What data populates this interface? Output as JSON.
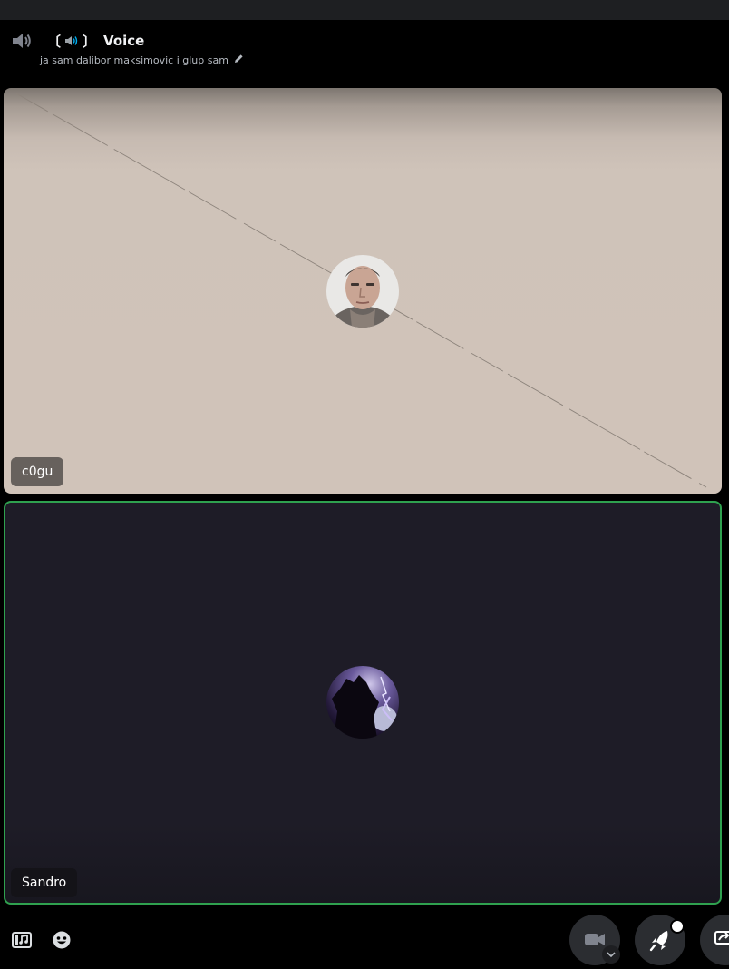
{
  "header": {
    "channel_icon": "speaker-icon",
    "title_icon": "speaker-icon",
    "title_bracket_left": "〔",
    "title_bracket_right": "〕",
    "title": "Voice",
    "subtitle": "ja sam dalibor maksimovic i glup sam",
    "edit_icon": "pencil-icon"
  },
  "participants": [
    {
      "name": "c0gu",
      "speaking": false,
      "avatar": "avatar-man-photo"
    },
    {
      "name": "Sandro",
      "speaking": true,
      "avatar": "avatar-dark-knight"
    }
  ],
  "bottom_bar": {
    "left_icons": [
      "soundboard-icon",
      "emoji-icon"
    ],
    "right_buttons": [
      "camera-icon",
      "activity-rocket-icon",
      "screen-share-icon"
    ]
  },
  "colors": {
    "background": "#000000",
    "speaking_border": "#2fa14f",
    "tile_dark": "#1e1c27",
    "tile_light": "#d0c3b9"
  }
}
